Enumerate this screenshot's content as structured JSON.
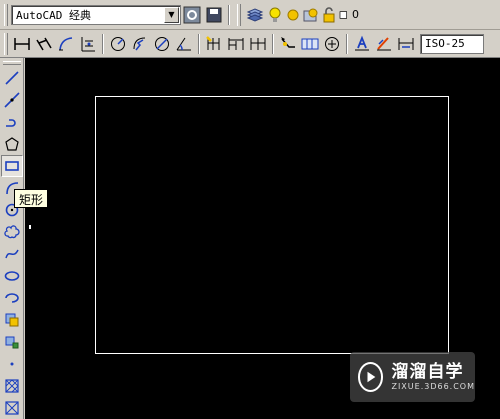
{
  "workspace": {
    "selected": "AutoCAD 经典"
  },
  "layer": {
    "name": "0"
  },
  "dimension_style": {
    "selected": "ISO-25"
  },
  "tooltip": {
    "text": "矩形"
  },
  "watermark": {
    "title": "溜溜自学",
    "url": "ZIXUE.3D66.COM"
  },
  "colors": {
    "toolbar_bg": "#d4d0c8",
    "canvas_bg": "#000000",
    "drawn_rect": "#ffffff",
    "tooltip_bg": "#ffffe1",
    "icon_blue": "#1b3fbf",
    "icon_yellow": "#f2c200"
  },
  "left_tools": [
    "line-icon",
    "construction-line-icon",
    "polyline-icon",
    "polygon-icon",
    "rectangle-icon",
    "arc-icon",
    "circle-icon",
    "revision-cloud-icon",
    "spline-icon",
    "ellipse-icon",
    "ellipse-arc-icon",
    "insert-block-icon",
    "make-block-icon",
    "point-icon",
    "hatch-icon",
    "gradient-icon"
  ]
}
